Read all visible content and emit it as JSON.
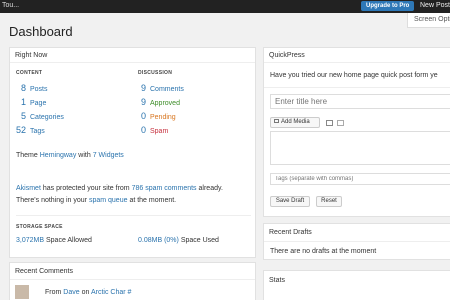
{
  "adminbar": {
    "site": "Tou...",
    "upgrade": "Upgrade to Pro",
    "new_post": "New Post"
  },
  "screen_options": "Screen Opti",
  "page_title": "Dashboard",
  "right_now": {
    "title": "Right Now",
    "content_head": "CONTENT",
    "discussion_head": "DISCUSSION",
    "content": [
      {
        "num": "8",
        "label": "Posts"
      },
      {
        "num": "1",
        "label": "Page"
      },
      {
        "num": "5",
        "label": "Categories"
      },
      {
        "num": "52",
        "label": "Tags"
      }
    ],
    "discussion": [
      {
        "num": "9",
        "label": "Comments"
      },
      {
        "num": "9",
        "label": "Approved"
      },
      {
        "num": "0",
        "label": "Pending"
      },
      {
        "num": "0",
        "label": "Spam"
      }
    ],
    "theme_prefix": "Theme",
    "theme_name": "Hemingway",
    "theme_with": "with",
    "widgets": "7 Widgets",
    "akismet_name": "Akismet",
    "akismet_mid": "has protected your site from",
    "spam_count": "786 spam comments",
    "akismet_end": "already.",
    "queue_prefix": "There's nothing in your",
    "spam_queue": "spam queue",
    "queue_end": "at the moment.",
    "storage_head": "STORAGE SPACE",
    "storage_allowed_val": "3,072MB",
    "storage_allowed_label": "Space Allowed",
    "storage_used_val": "0.08MB (0%)",
    "storage_used_label": "Space Used"
  },
  "recent_comments": {
    "title": "Recent Comments",
    "from": "From",
    "author": "Dave",
    "on": "on",
    "post": "Arctic Char #"
  },
  "quickpress": {
    "title": "QuickPress",
    "notice": "Have you tried our new home page quick post form ye",
    "title_placeholder": "Enter title here",
    "add_media": "Add Media",
    "tags_placeholder": "Tags (separate with commas)",
    "save_draft": "Save Draft",
    "reset": "Reset"
  },
  "recent_drafts": {
    "title": "Recent Drafts",
    "empty": "There are no drafts at the moment"
  },
  "stats": {
    "title": "Stats"
  }
}
